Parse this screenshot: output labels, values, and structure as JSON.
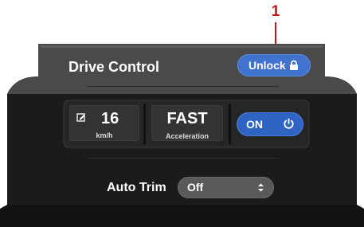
{
  "annotation": {
    "number": "1"
  },
  "panel": {
    "title": "Drive Control",
    "unlock_button": {
      "label": "Unlock",
      "icon": "lock-icon"
    }
  },
  "gauges": {
    "speed": {
      "value": "16",
      "unit": "km/h",
      "icon": "edit-icon"
    },
    "acceleration": {
      "value": "FAST",
      "label": "Acceleration"
    },
    "power_button": {
      "label": "ON",
      "icon": "power-icon"
    }
  },
  "auto_trim": {
    "label": "Auto Trim",
    "selected": "Off",
    "icon": "updown-chevron-icon"
  },
  "colors": {
    "accent_blue": "#3f73cd",
    "callout_red": "#c01818",
    "panel_dark": "#1c1c1c"
  }
}
